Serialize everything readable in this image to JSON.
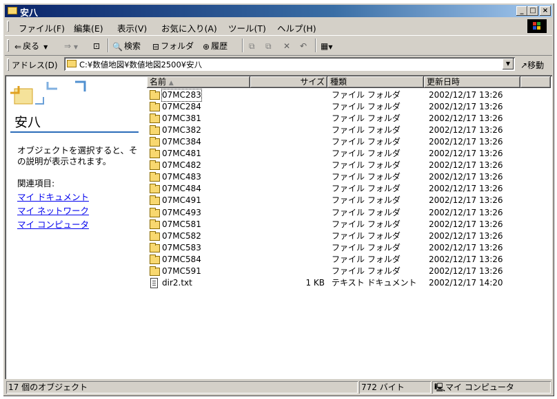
{
  "window": {
    "title": "安八"
  },
  "menu": [
    "ファイル(F)",
    "編集(E)",
    "表示(V)",
    "お気に入り(A)",
    "ツール(T)",
    "ヘルプ(H)"
  ],
  "toolbar": {
    "back": "戻る",
    "search": "検索",
    "folders": "フォルダ",
    "history": "履歴"
  },
  "address": {
    "label": "アドレス(D)",
    "value": "C:¥数値地図¥数値地図2500¥安八",
    "go": "移動"
  },
  "left_panel": {
    "title": "安八",
    "description": "オブジェクトを選択すると、その説明が表示されます。",
    "related_heading": "関連項目:",
    "links": [
      "マイ ドキュメント",
      "マイ ネットワーク",
      "マイ コンピュータ"
    ]
  },
  "columns": {
    "name": "名前",
    "size": "サイズ",
    "type": "種類",
    "modified": "更新日時"
  },
  "files": [
    {
      "name": "07MC283",
      "size": "",
      "type": "ファイル フォルダ",
      "modified": "2002/12/17 13:26",
      "kind": "folder"
    },
    {
      "name": "07MC284",
      "size": "",
      "type": "ファイル フォルダ",
      "modified": "2002/12/17 13:26",
      "kind": "folder"
    },
    {
      "name": "07MC381",
      "size": "",
      "type": "ファイル フォルダ",
      "modified": "2002/12/17 13:26",
      "kind": "folder"
    },
    {
      "name": "07MC382",
      "size": "",
      "type": "ファイル フォルダ",
      "modified": "2002/12/17 13:26",
      "kind": "folder"
    },
    {
      "name": "07MC384",
      "size": "",
      "type": "ファイル フォルダ",
      "modified": "2002/12/17 13:26",
      "kind": "folder"
    },
    {
      "name": "07MC481",
      "size": "",
      "type": "ファイル フォルダ",
      "modified": "2002/12/17 13:26",
      "kind": "folder"
    },
    {
      "name": "07MC482",
      "size": "",
      "type": "ファイル フォルダ",
      "modified": "2002/12/17 13:26",
      "kind": "folder"
    },
    {
      "name": "07MC483",
      "size": "",
      "type": "ファイル フォルダ",
      "modified": "2002/12/17 13:26",
      "kind": "folder"
    },
    {
      "name": "07MC484",
      "size": "",
      "type": "ファイル フォルダ",
      "modified": "2002/12/17 13:26",
      "kind": "folder"
    },
    {
      "name": "07MC491",
      "size": "",
      "type": "ファイル フォルダ",
      "modified": "2002/12/17 13:26",
      "kind": "folder"
    },
    {
      "name": "07MC493",
      "size": "",
      "type": "ファイル フォルダ",
      "modified": "2002/12/17 13:26",
      "kind": "folder"
    },
    {
      "name": "07MC581",
      "size": "",
      "type": "ファイル フォルダ",
      "modified": "2002/12/17 13:26",
      "kind": "folder"
    },
    {
      "name": "07MC582",
      "size": "",
      "type": "ファイル フォルダ",
      "modified": "2002/12/17 13:26",
      "kind": "folder"
    },
    {
      "name": "07MC583",
      "size": "",
      "type": "ファイル フォルダ",
      "modified": "2002/12/17 13:26",
      "kind": "folder"
    },
    {
      "name": "07MC584",
      "size": "",
      "type": "ファイル フォルダ",
      "modified": "2002/12/17 13:26",
      "kind": "folder"
    },
    {
      "name": "07MC591",
      "size": "",
      "type": "ファイル フォルダ",
      "modified": "2002/12/17 13:26",
      "kind": "folder"
    },
    {
      "name": "dir2.txt",
      "size": "1 KB",
      "type": "テキスト ドキュメント",
      "modified": "2002/12/17 14:20",
      "kind": "text"
    }
  ],
  "status": {
    "objects": "17 個のオブジェクト",
    "bytes": "772 バイト",
    "location": "マイ コンピュータ"
  }
}
